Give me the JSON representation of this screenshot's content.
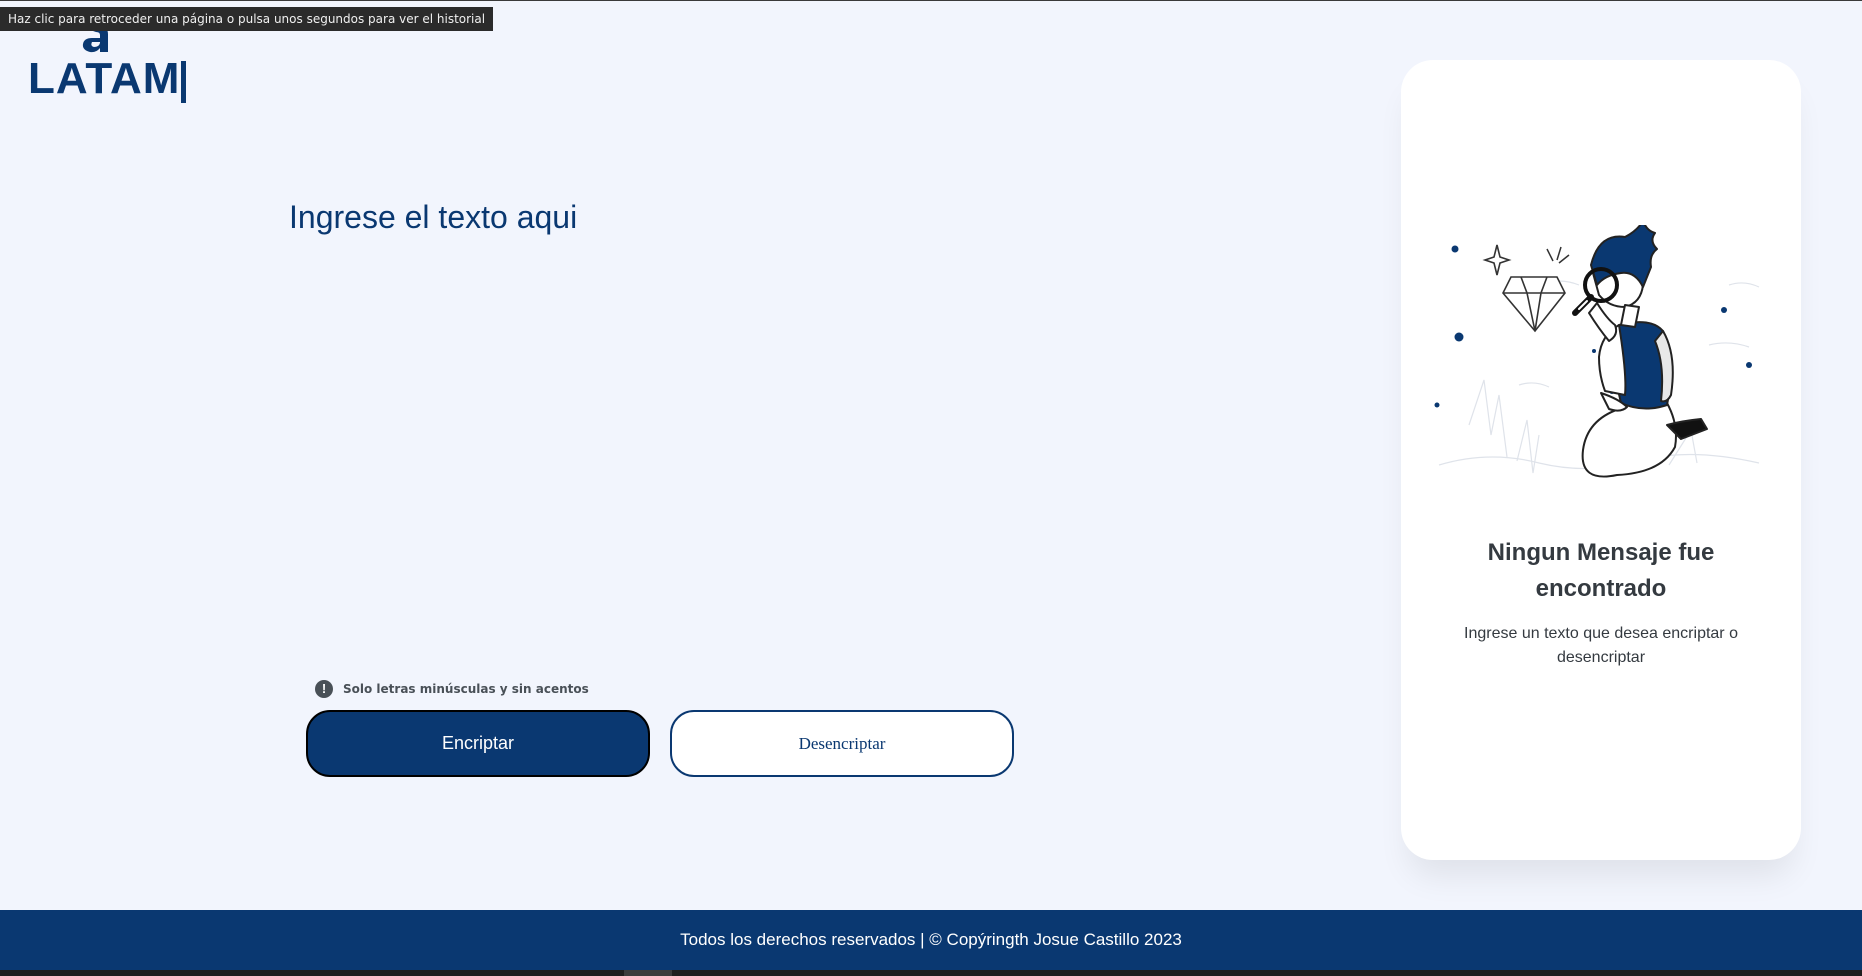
{
  "browser": {
    "tooltip": "Haz clic para retroceder una página o pulsa unos segundos para ver el historial"
  },
  "header": {
    "logo_text": "LATAM"
  },
  "main": {
    "input_placeholder": "Ingrese el texto aqui",
    "input_value": "",
    "hint_icon": "exclamation-icon",
    "hint": "Solo letras minúsculas y sin acentos",
    "encrypt_label": "Encriptar",
    "decrypt_label": "Desencriptar"
  },
  "result_panel": {
    "illustration": "person-with-magnifying-glass-and-diamond",
    "title": "Ningun Mensaje fue encontrado",
    "subtitle": "Ingrese un texto que desea encriptar o desencriptar"
  },
  "footer": {
    "text": "Todos los derechos reservados | © Copýringth Josue Castillo 2023"
  },
  "colors": {
    "primary": "#0a3871",
    "background": "#f2f5fd",
    "card": "#ffffff",
    "hint": "#495057"
  }
}
